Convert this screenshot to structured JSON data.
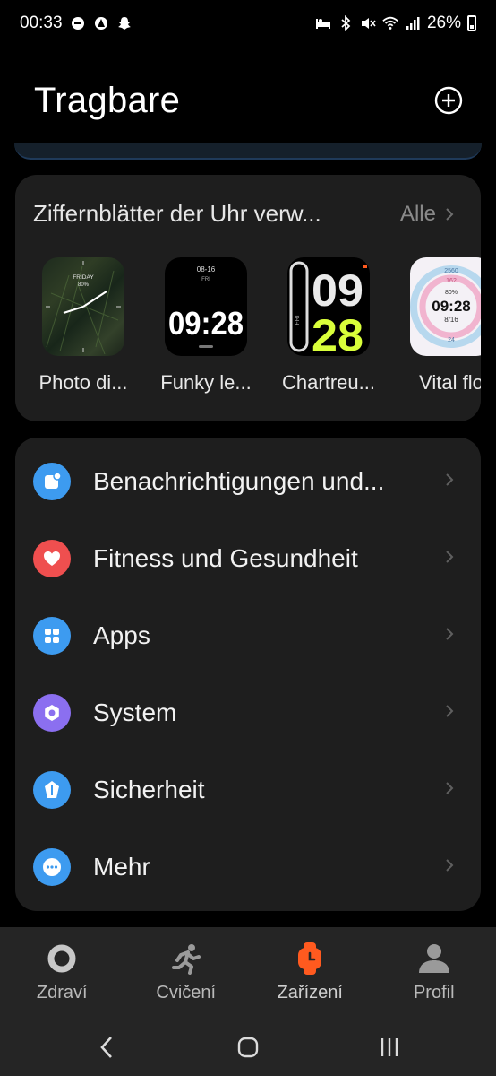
{
  "status_bar": {
    "time": "00:33",
    "battery": "26%",
    "left_icons": [
      "dnd-icon",
      "alert-icon",
      "snapchat-icon"
    ],
    "right_icons": [
      "sleep-icon",
      "bluetooth-icon",
      "mute-icon",
      "wifi-icon",
      "signal-icon",
      "battery-icon"
    ]
  },
  "header": {
    "title": "Tragbare",
    "add_icon": "plus-circle-icon"
  },
  "watch_faces": {
    "title": "Ziffernblätter der Uhr verw...",
    "all_label": "Alle",
    "items": [
      {
        "label": "Photo di...",
        "day": "FRIDAY",
        "pct": "80%"
      },
      {
        "label": "Funky le...",
        "date": "08-16",
        "day": "FRI",
        "time": "09:28"
      },
      {
        "label": "Chartreu...",
        "hour": "09",
        "minute": "28",
        "side": "FRI"
      },
      {
        "label": "Vital flo",
        "steps": "2560",
        "hr": "162",
        "battery": "80%",
        "time": "09:28",
        "date": "8/16",
        "cal": "24"
      }
    ]
  },
  "menu": {
    "items": [
      {
        "label": "Benachrichtigungen und...",
        "icon": "notification-icon",
        "color": "#3d9bf0"
      },
      {
        "label": "Fitness und Gesundheit",
        "icon": "heart-icon",
        "color": "#ef4f4f"
      },
      {
        "label": "Apps",
        "icon": "apps-grid-icon",
        "color": "#3d9bf0"
      },
      {
        "label": "System",
        "icon": "system-gear-icon",
        "color": "#8b6ff0"
      },
      {
        "label": "Sicherheit",
        "icon": "shield-icon",
        "color": "#3d9bf0"
      },
      {
        "label": "Mehr",
        "icon": "more-dots-icon",
        "color": "#3d9bf0"
      }
    ]
  },
  "bottom_nav": {
    "items": [
      {
        "label": "Zdraví",
        "icon": "ring-icon"
      },
      {
        "label": "Cvičení",
        "icon": "runner-icon"
      },
      {
        "label": "Zařízení",
        "icon": "watch-icon",
        "active": true,
        "color": "#ff5a1f"
      },
      {
        "label": "Profil",
        "icon": "person-icon"
      }
    ]
  },
  "system_nav": [
    "back-icon",
    "home-icon",
    "recents-icon"
  ]
}
